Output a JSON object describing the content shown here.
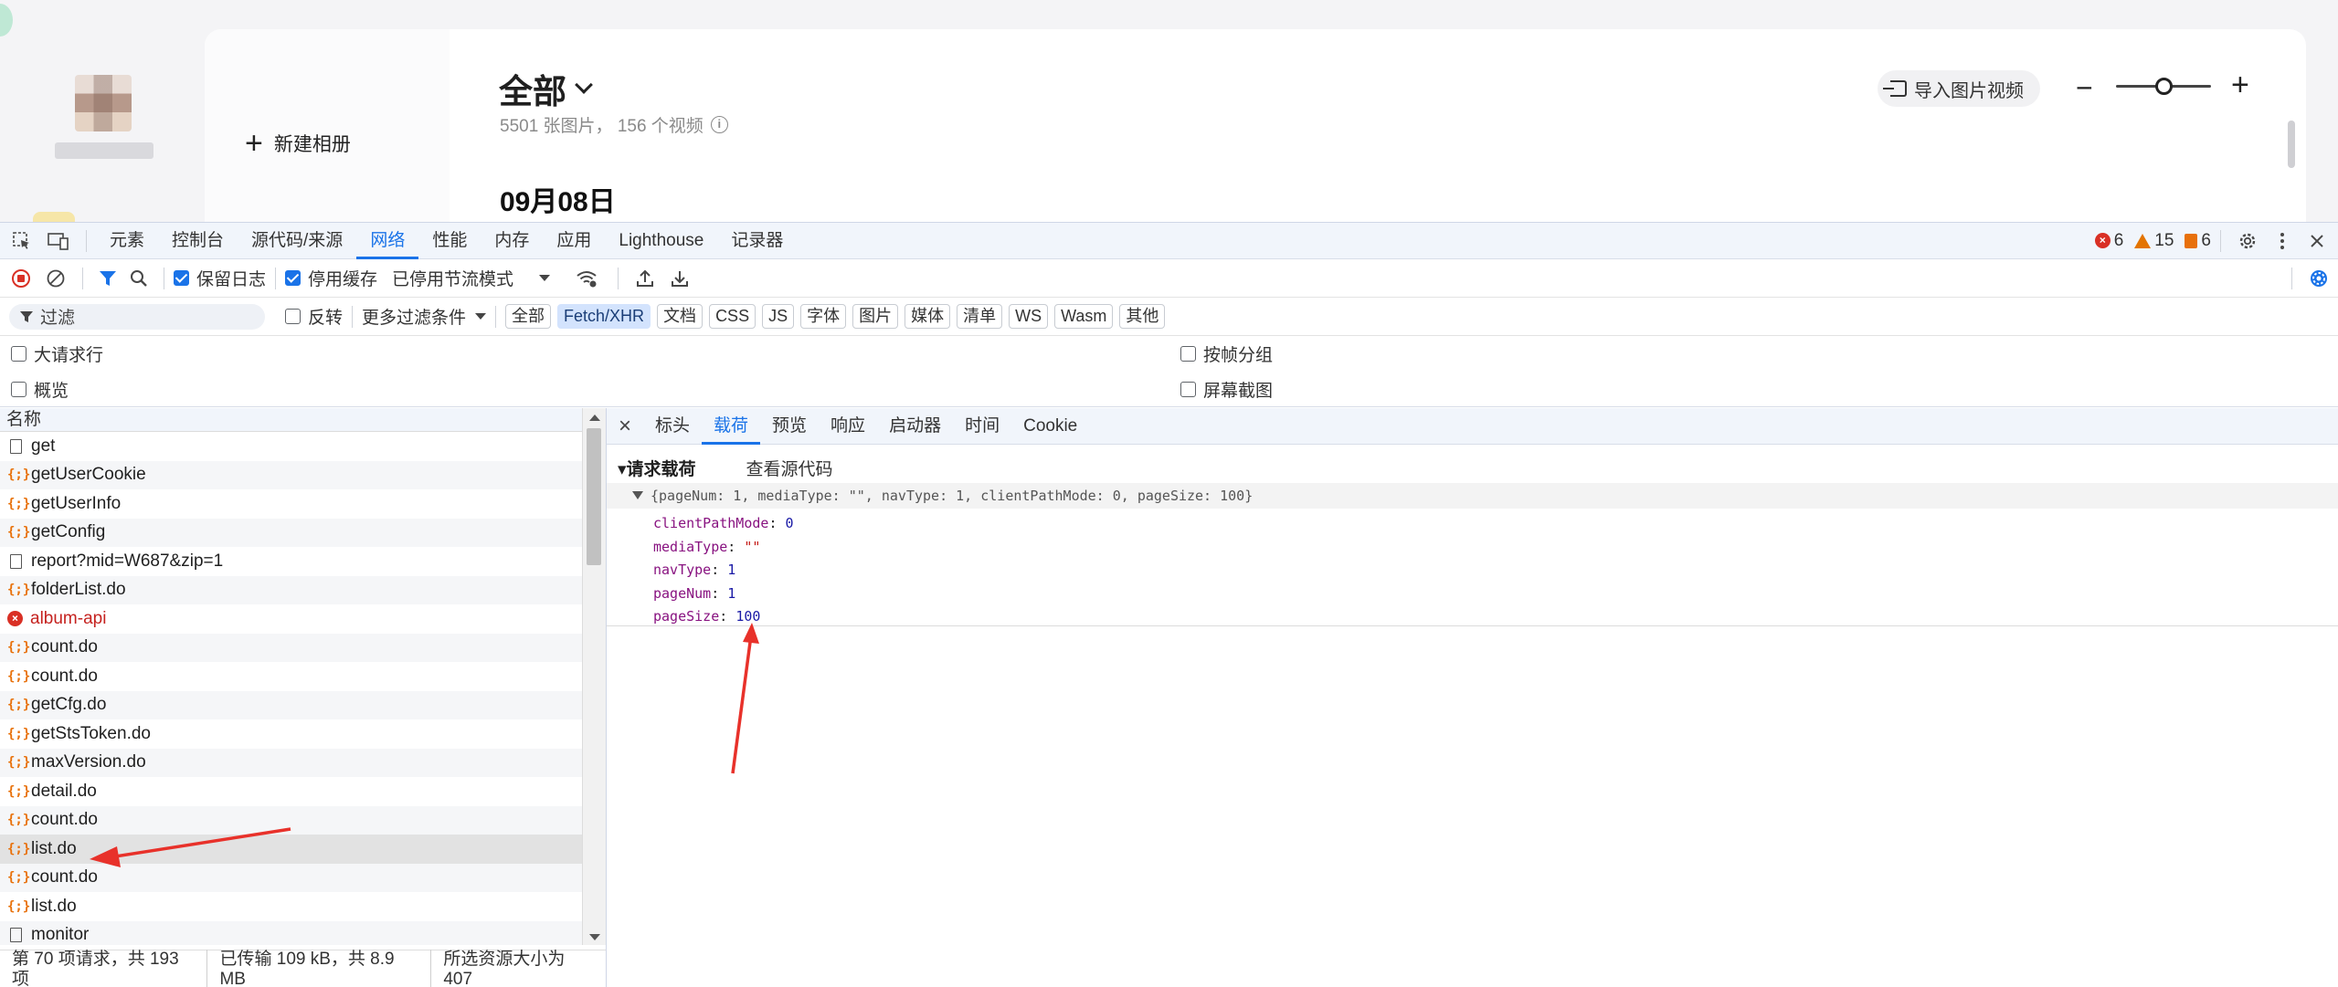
{
  "app": {
    "new_album_label": "新建相册",
    "album_title": "全部",
    "stats": "5501 张图片， 156 个视频",
    "date_header_partial": "09月08日",
    "import_button": "导入图片视频",
    "zoom_minus": "−",
    "zoom_plus": "+",
    "zoom_level": 0.5
  },
  "devtools": {
    "tabs": [
      "元素",
      "控制台",
      "源代码/来源",
      "网络",
      "性能",
      "内存",
      "应用",
      "Lighthouse",
      "记录器"
    ],
    "active_tab": "网络",
    "counts": {
      "errors": "6",
      "warnings": "15",
      "issues": "6"
    },
    "toolbar": {
      "preserve_log": "保留日志",
      "disable_cache": "停用缓存",
      "throttling": "已停用节流模式"
    },
    "filter": {
      "placeholder": "过滤",
      "invert": "反转",
      "more_filters": "更多过滤条件",
      "types": [
        "全部",
        "Fetch/XHR",
        "文档",
        "CSS",
        "JS",
        "字体",
        "图片",
        "媒体",
        "清单",
        "WS",
        "Wasm",
        "其他"
      ],
      "active_type": "Fetch/XHR"
    },
    "options": {
      "big_request_rows": "大请求行",
      "group_by_frame": "按帧分组",
      "overview": "概览",
      "screenshots": "屏幕截图"
    },
    "request_list": {
      "header": "名称",
      "items": [
        {
          "name": "get",
          "type": "doc"
        },
        {
          "name": "getUserCookie",
          "type": "fetch"
        },
        {
          "name": "getUserInfo",
          "type": "fetch"
        },
        {
          "name": "getConfig",
          "type": "fetch"
        },
        {
          "name": "report?mid=W687&zip=1",
          "type": "doc"
        },
        {
          "name": "folderList.do",
          "type": "fetch"
        },
        {
          "name": "album-api",
          "type": "error"
        },
        {
          "name": "count.do",
          "type": "fetch"
        },
        {
          "name": "count.do",
          "type": "fetch"
        },
        {
          "name": "getCfg.do",
          "type": "fetch"
        },
        {
          "name": "getStsToken.do",
          "type": "fetch"
        },
        {
          "name": "maxVersion.do",
          "type": "fetch"
        },
        {
          "name": "detail.do",
          "type": "fetch"
        },
        {
          "name": "count.do",
          "type": "fetch"
        },
        {
          "name": "list.do",
          "type": "fetch",
          "selected": true
        },
        {
          "name": "count.do",
          "type": "fetch"
        },
        {
          "name": "list.do",
          "type": "fetch"
        },
        {
          "name": "monitor",
          "type": "doc"
        }
      ]
    },
    "detail": {
      "tabs": [
        "标头",
        "载荷",
        "预览",
        "响应",
        "启动器",
        "时间",
        "Cookie"
      ],
      "active_tab": "载荷",
      "payload_title": "▾请求载荷",
      "view_source": "查看源代码",
      "summary": "{pageNum: 1, mediaType: \"\", navType: 1, clientPathMode: 0, pageSize: 100}",
      "props": [
        {
          "key": "clientPathMode",
          "value": "0",
          "kind": "num"
        },
        {
          "key": "mediaType",
          "value": "\"\"",
          "kind": "str"
        },
        {
          "key": "navType",
          "value": "1",
          "kind": "num"
        },
        {
          "key": "pageNum",
          "value": "1",
          "kind": "num"
        },
        {
          "key": "pageSize",
          "value": "100",
          "kind": "num"
        }
      ]
    },
    "status": {
      "requests": "第 70 项请求，共 193 项",
      "transferred": "已传输 109 kB，共 8.9 MB",
      "selected_size": "所选资源大小为 407"
    }
  },
  "colors": {
    "accent": "#1a73e8",
    "annotation_arrow": "#e8312a",
    "error": "#d93025",
    "warning": "#e37400",
    "fetch_icon": "#e8710a"
  }
}
